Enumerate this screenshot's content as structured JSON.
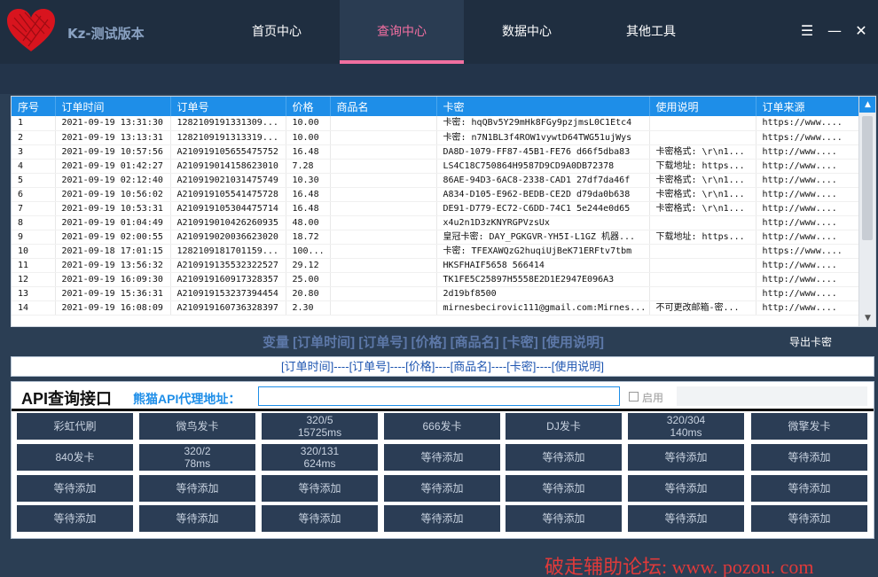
{
  "app": {
    "title": "Kz-测试版本"
  },
  "tabs": [
    "首页中心",
    "查询中心",
    "数据中心",
    "其他工具"
  ],
  "active_tab": 1,
  "window": {
    "menu": "☰",
    "minimize": "—",
    "close": "✕"
  },
  "grid": {
    "columns": [
      "序号",
      "订单时间",
      "订单号",
      "价格",
      "商品名",
      "卡密",
      "使用说明",
      "订单来源"
    ],
    "rows": [
      [
        "1",
        "2021-09-19 13:31:30",
        "1282109191331309...",
        "10.00",
        "",
        "卡密: hqQBv5Y29mHk8FGy9pzjmsL0C1Etc4",
        "",
        "https://www...."
      ],
      [
        "2",
        "2021-09-19 13:13:31",
        "1282109191313319...",
        "10.00",
        "",
        "卡密: n7N1BL3f4ROW1vywtD64TWG51ujWys",
        "",
        "https://www...."
      ],
      [
        "3",
        "2021-09-19 10:57:56",
        "A21091910565547575​2",
        "16.48",
        "",
        "DA8D-1079-FF87-45B1-FE76 d66f5dba83",
        "卡密格式: \\r\\n1...",
        "http://www...."
      ],
      [
        "4",
        "2021-09-19 01:42:27",
        "A21091901415862301​0",
        "7.28",
        "",
        "LS4C18C750864H9587D9CD9A0DB72378",
        "下载地址: https...",
        "http://www...."
      ],
      [
        "5",
        "2021-09-19 02:12:40",
        "A21091902103147574​9",
        "10.30",
        "",
        "86AE-94D3-6AC8-2338-CAD1 27df7da46f",
        "卡密格式: \\r\\n1...",
        "http://www...."
      ],
      [
        "6",
        "2021-09-19 10:56:02",
        "A21091910554147572​8",
        "16.48",
        "",
        "A834-D105-E962-BEDB-CE2D d79da0b638",
        "卡密格式: \\r\\n1...",
        "http://www...."
      ],
      [
        "7",
        "2021-09-19 10:53:31",
        "A21091910530447571​4",
        "16.48",
        "",
        "DE91-D779-EC72-C6DD-74C1 5e244e0d65",
        "卡密格式: \\r\\n1...",
        "http://www...."
      ],
      [
        "8",
        "2021-09-19 01:04:49",
        "A21091901042626093​5",
        "48.00",
        "",
        "x4u2n1D3zKNYRGPVzsUx",
        "",
        "http://www...."
      ],
      [
        "9",
        "2021-09-19 02:00:55",
        "A21091902003662302​0",
        "18.72",
        "",
        "皇冠卡密: DAY_PGKGVR-YH5I-L1GZ 机器...",
        "下载地址: https...",
        "http://www...."
      ],
      [
        "10",
        "2021-09-18 17:01:15",
        "1282109181701159...",
        "100...",
        "",
        "卡密: TFEXAWQzG2huqiUjBeK71ERFtv7tbm",
        "",
        "https://www...."
      ],
      [
        "11",
        "2021-09-19 13:56:32",
        "A21091913553232252​7",
        "29.12",
        "",
        "HKSFHAIF5658 566414",
        "",
        "http://www...."
      ],
      [
        "12",
        "2021-09-19 16:09:30",
        "A21091916091732835​7",
        "25.00",
        "",
        "TK1FE5C25897H5558E2D1E2947E096A3",
        "",
        "http://www...."
      ],
      [
        "13",
        "2021-09-19 15:36:31",
        "A21091915323739445​4",
        "20.80",
        "",
        "2d19bf8500",
        "",
        "http://www...."
      ],
      [
        "14",
        "2021-09-19 16:08:09",
        "A21091916073632839​7",
        "2.30",
        "",
        "mirnesbecirovic111@gmail.com:Mirnes...",
        "不可更改邮箱-密...",
        "http://www...."
      ]
    ]
  },
  "variables_line": "变量 [订单时间] [订单号] [价格] [商品名] [卡密] [使用说明]",
  "export_label": "导出卡密",
  "template": "[订单时间]----[订单号]----[价格]----[商品名]----[卡密]----[使用说明]",
  "api": {
    "title": "API查询接口",
    "proxy_label": "熊猫API代理地址：",
    "proxy_value": "",
    "enable_label": "启用",
    "buttons": [
      [
        "彩虹代刷",
        "微鸟发卡",
        "320/5\n15725ms",
        "666发卡",
        "DJ发卡",
        "320/304\n140ms",
        "微擎发卡"
      ],
      [
        "840发卡",
        "320/2\n78ms",
        "320/131\n624ms",
        "等待添加",
        "等待添加",
        "等待添加",
        "等待添加"
      ],
      [
        "等待添加",
        "等待添加",
        "等待添加",
        "等待添加",
        "等待添加",
        "等待添加",
        "等待添加"
      ],
      [
        "等待添加",
        "等待添加",
        "等待添加",
        "等待添加",
        "等待添加",
        "等待添加",
        "等待添加"
      ]
    ]
  },
  "watermark": "破走辅助论坛: www. pozou. com",
  "colors": {
    "accent": "#1e8ee8",
    "active_tab": "#f36fa1",
    "background": "#2b3e54"
  }
}
